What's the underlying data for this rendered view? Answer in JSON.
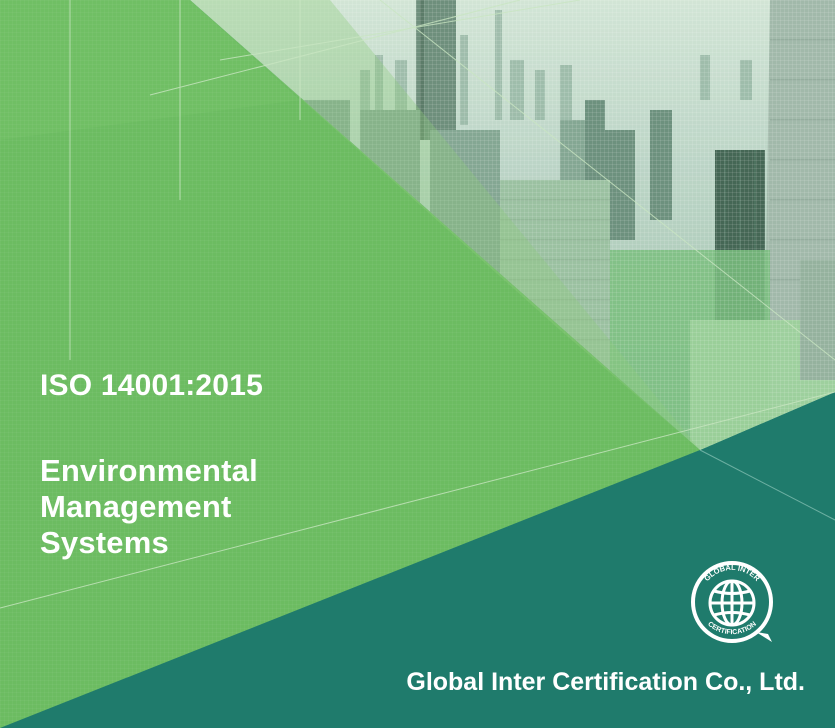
{
  "cover": {
    "standard": "ISO 14001:2015",
    "title_lines": [
      "Environmental",
      "Management",
      "Systems"
    ],
    "company": "Global Inter Certification Co., Ltd."
  },
  "logo": {
    "text_top": "GLOBAL INTER",
    "text_bottom": "CERTIFICATION",
    "icon": "globe-icon"
  },
  "colors": {
    "dark_teal": "#1f7b6c",
    "light_green": "#6cbc61",
    "mid_green": "#82c46f",
    "sky": "#dfe6e8",
    "buildings": "#8fa8a3"
  }
}
